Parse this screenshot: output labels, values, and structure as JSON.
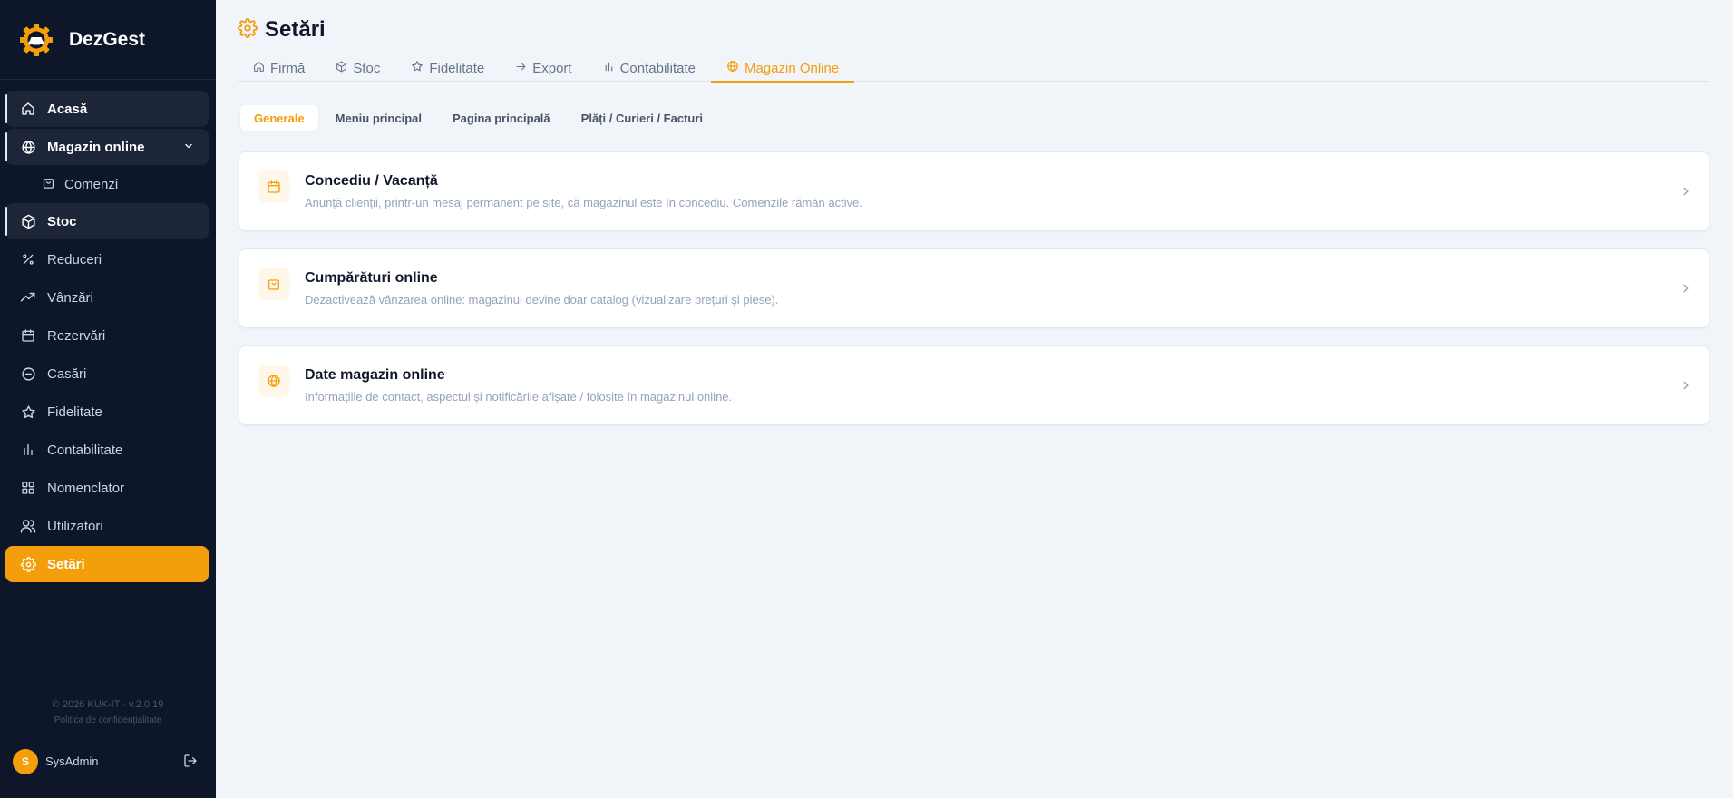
{
  "brand": {
    "name": "DezGest",
    "logo_icon": "gear-car-logo"
  },
  "sidebar": {
    "items": [
      {
        "label": "Acasă",
        "icon": "home-icon"
      },
      {
        "label": "Magazin online",
        "icon": "globe-icon"
      },
      {
        "label": "Comenzi",
        "icon": "bag-icon"
      },
      {
        "label": "Stoc",
        "icon": "box-icon"
      },
      {
        "label": "Reduceri",
        "icon": "percent-icon"
      },
      {
        "label": "Vânzări",
        "icon": "trend-icon"
      },
      {
        "label": "Rezervări",
        "icon": "calendar-icon"
      },
      {
        "label": "Casări",
        "icon": "minus-circle-icon"
      },
      {
        "label": "Fidelitate",
        "icon": "star-icon"
      },
      {
        "label": "Contabilitate",
        "icon": "bar-chart-icon"
      },
      {
        "label": "Nomenclator",
        "icon": "grid-icon"
      },
      {
        "label": "Utilizatori",
        "icon": "users-icon"
      },
      {
        "label": "Setări",
        "icon": "gear-icon"
      }
    ],
    "copyright": "© 2026 KUK-IT · v.2.0.19",
    "privacy": "Politica de confidențialitate",
    "user": {
      "initial": "S",
      "name": "SysAdmin"
    }
  },
  "header": {
    "title": "Setări"
  },
  "tabs": [
    {
      "label": "Firmă"
    },
    {
      "label": "Stoc"
    },
    {
      "label": "Fidelitate"
    },
    {
      "label": "Export"
    },
    {
      "label": "Contabilitate"
    },
    {
      "label": "Magazin Online"
    }
  ],
  "subtabs": [
    {
      "label": "Generale"
    },
    {
      "label": "Meniu principal"
    },
    {
      "label": "Pagina principală"
    },
    {
      "label": "Plăți / Curieri / Facturi"
    }
  ],
  "cards": [
    {
      "title": "Concediu / Vacanță",
      "description": "Anunță clienții, printr-un mesaj permanent pe site, că magazinul este în concediu. Comenzile rămân active.",
      "icon": "calendar-icon"
    },
    {
      "title": "Cumpărături online",
      "description": "Dezactivează vânzarea online: magazinul devine doar catalog (vizualizare prețuri și piese).",
      "icon": "bag-icon"
    },
    {
      "title": "Date magazin online",
      "description": "Informațiile de contact, aspectul și notificările afișate / folosite în magazinul online.",
      "icon": "globe-icon"
    }
  ],
  "colors": {
    "accent": "#f59e0b",
    "sidebar_bg": "#0e1729",
    "page_bg": "#f1f4f9"
  }
}
